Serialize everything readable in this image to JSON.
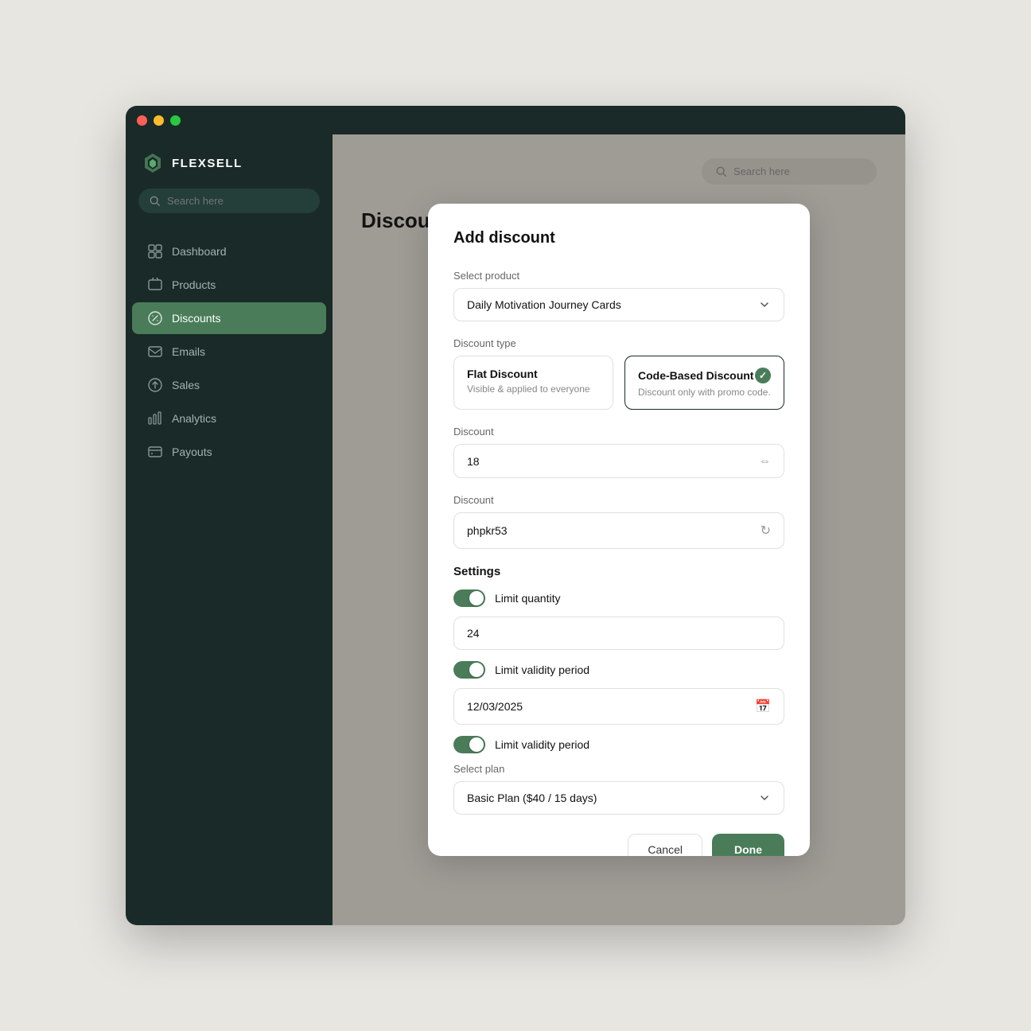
{
  "window": {
    "titlebar_buttons": [
      "close",
      "minimize",
      "maximize"
    ]
  },
  "sidebar": {
    "logo_text": "FLEXSELL",
    "search_placeholder": "Search here",
    "nav_items": [
      {
        "id": "dashboard",
        "label": "Dashboard",
        "active": false
      },
      {
        "id": "products",
        "label": "Products",
        "active": false
      },
      {
        "id": "discounts",
        "label": "Discounts",
        "active": true
      },
      {
        "id": "emails",
        "label": "Emails",
        "active": false
      },
      {
        "id": "sales",
        "label": "Sales",
        "active": false
      },
      {
        "id": "analytics",
        "label": "Analytics",
        "active": false
      },
      {
        "id": "payouts",
        "label": "Payouts",
        "active": false
      }
    ]
  },
  "main": {
    "page_title": "Discounts",
    "search_placeholder": "Search here"
  },
  "modal": {
    "title": "Add discount",
    "select_product_label": "Select product",
    "selected_product": "Daily Motivation Journey Cards",
    "discount_type_label": "Discount type",
    "discount_types": [
      {
        "id": "flat",
        "title": "Flat Discount",
        "description": "Visible & applied to everyone",
        "selected": false
      },
      {
        "id": "code",
        "title": "Code-Based Discount",
        "description": "Discount only with promo code.",
        "selected": true
      }
    ],
    "discount_label": "Discount",
    "discount_value": "18",
    "promo_code_label": "Discount",
    "promo_code_value": "phpkr53",
    "settings_label": "Settings",
    "toggles": [
      {
        "id": "limit_quantity",
        "label": "Limit quantity",
        "enabled": true
      },
      {
        "id": "limit_validity",
        "label": "Limit validity period",
        "enabled": true
      },
      {
        "id": "limit_validity2",
        "label": "Limit validity period",
        "enabled": true
      }
    ],
    "quantity_value": "24",
    "date_value": "12/03/2025",
    "select_plan_label": "Select plan",
    "selected_plan": "Basic Plan ($40 / 15 days)",
    "cancel_label": "Cancel",
    "done_label": "Done"
  }
}
